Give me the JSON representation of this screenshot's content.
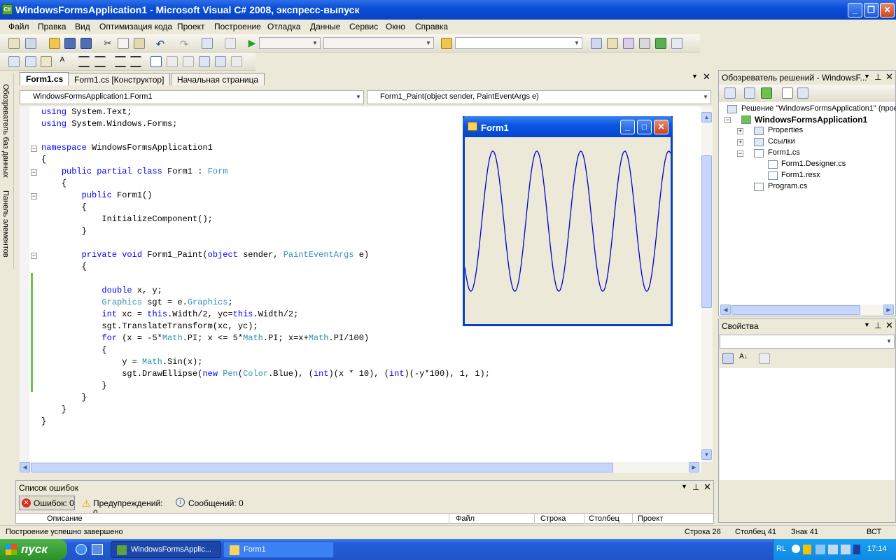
{
  "window": {
    "title": "WindowsFormsApplication1 - Microsoft Visual C# 2008, экспресс-выпуск"
  },
  "menu": [
    "Файл",
    "Правка",
    "Вид",
    "Оптимизация кода",
    "Проект",
    "Построение",
    "Отладка",
    "Данные",
    "Сервис",
    "Окно",
    "Справка"
  ],
  "side_tabs": {
    "db": "Обозреватель баз данных",
    "toolbox": "Панель элементов"
  },
  "tabs": [
    "Form1.cs",
    "Form1.cs [Конструктор]",
    "Начальная страница"
  ],
  "nav": {
    "class_combo": "WindowsFormsApplication1.Form1",
    "member_combo": "Form1_Paint(object sender, PaintEventArgs e)"
  },
  "code_lines": [
    "using System.Text;",
    "using System.Windows.Forms;",
    "",
    "namespace WindowsFormsApplication1",
    "{",
    "    public partial class Form1 : Form",
    "    {",
    "        public Form1()",
    "        {",
    "            InitializeComponent();",
    "        }",
    "",
    "        private void Form1_Paint(object sender, PaintEventArgs e)",
    "        {",
    "",
    "            double x, y;",
    "            Graphics sgt = e.Graphics;",
    "            int xc = this.Width/2, yc=this.Width/2;",
    "            sgt.TranslateTransform(xc, yc);",
    "            for (x = -5*Math.PI; x <= 5*Math.PI; x=x+Math.PI/100)",
    "            {",
    "                y = Math.Sin(x);",
    "                sgt.DrawEllipse(new Pen(Color.Blue), (int)(x * 10), (int)(-y*100), 1, 1);",
    "            }",
    "        }",
    "    }",
    "}"
  ],
  "form1": {
    "title": "Form1",
    "curve_color": "#0000cc"
  },
  "solution_explorer": {
    "title": "Обозреватель решений - WindowsF...",
    "items": [
      "Решение \"WindowsFormsApplication1\" (прое",
      "WindowsFormsApplication1",
      "Properties",
      "Ссылки",
      "Form1.cs",
      "Form1.Designer.cs",
      "Form1.resx",
      "Program.cs"
    ]
  },
  "properties": {
    "title": "Свойства"
  },
  "error_list": {
    "title": "Список ошибок",
    "errors": "Ошибок: 0",
    "warnings": "Предупреждений: 0",
    "messages": "Сообщений: 0",
    "columns": [
      "Описание",
      "Файл",
      "Строка",
      "Столбец",
      "Проект"
    ]
  },
  "status": {
    "message": "Построение успешно завершено",
    "line": "Строка 26",
    "col": "Столбец 41",
    "char": "Знак 41",
    "mode": "ВСТ"
  },
  "taskbar": {
    "start": "пуск",
    "tasks": [
      "WindowsFormsApplic...",
      "Form1"
    ],
    "lang": "RL",
    "time": "17:14"
  }
}
